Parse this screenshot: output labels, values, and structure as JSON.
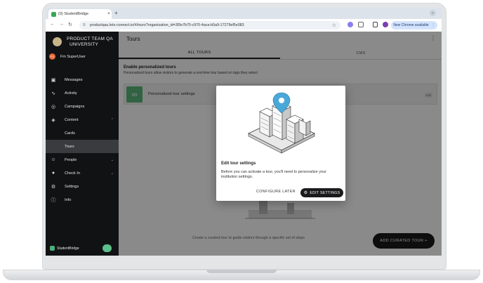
{
  "browser": {
    "tab_title": "(0) StudentBridge",
    "tab_close": "×",
    "new_tab": "+",
    "url": "productqau.lets-connect.io/#/tours?organization_id=3f3e7b70-c970-4aca-b5a9-17279ef5e083",
    "chrome_available": "New Chrome available",
    "tab_menu": "⌄",
    "menu": "⋮"
  },
  "sidebar": {
    "org_name_line1": "PRODUCT TEAM QA",
    "org_name_line2": "UNIVERSITY",
    "user_name": "Fm SuperUser",
    "user_initials": "FS",
    "items": [
      {
        "label": "Messages",
        "icon": "inbox-icon"
      },
      {
        "label": "Activity",
        "icon": "activity-icon"
      },
      {
        "label": "Campaigns",
        "icon": "campaign-icon"
      },
      {
        "label": "Content",
        "icon": "layers-icon"
      },
      {
        "label": "Cards",
        "icon": ""
      },
      {
        "label": "Tours",
        "icon": ""
      },
      {
        "label": "People",
        "icon": "people-icon"
      },
      {
        "label": "Check In",
        "icon": "location-pin-icon"
      },
      {
        "label": "Settings",
        "icon": "gear-icon"
      },
      {
        "label": "Info",
        "icon": "info-icon"
      }
    ],
    "footer_brand": "StudentBridge"
  },
  "main": {
    "title": "Tours",
    "tabs": [
      {
        "label": "ALL TOURS",
        "active": true
      },
      {
        "label": "CMS",
        "active": false
      }
    ],
    "personalize_heading": "Enable personalized tours",
    "personalize_sub": "Personalized tours allow visitors to generate a real-time tour based on tags they select",
    "card_label": "Personalized tour settings",
    "card_edit": "Edit",
    "empty_text": "Create a curated tour to guide visitors through a specific set of stops",
    "add_button": "ADD CURATED TOUR +"
  },
  "modal": {
    "title": "Edit tour settings",
    "body": "Before you can activate a tour, you'll need to personalize your institution settings.",
    "later_button": "CONFIGURE LATER",
    "edit_button": "EDIT SETTINGS"
  },
  "colors": {
    "sidebar_bg": "#111214",
    "accent_green": "#5cb87a",
    "pin_blue": "#4aa8d8",
    "button_dark": "#1b1b1d"
  }
}
